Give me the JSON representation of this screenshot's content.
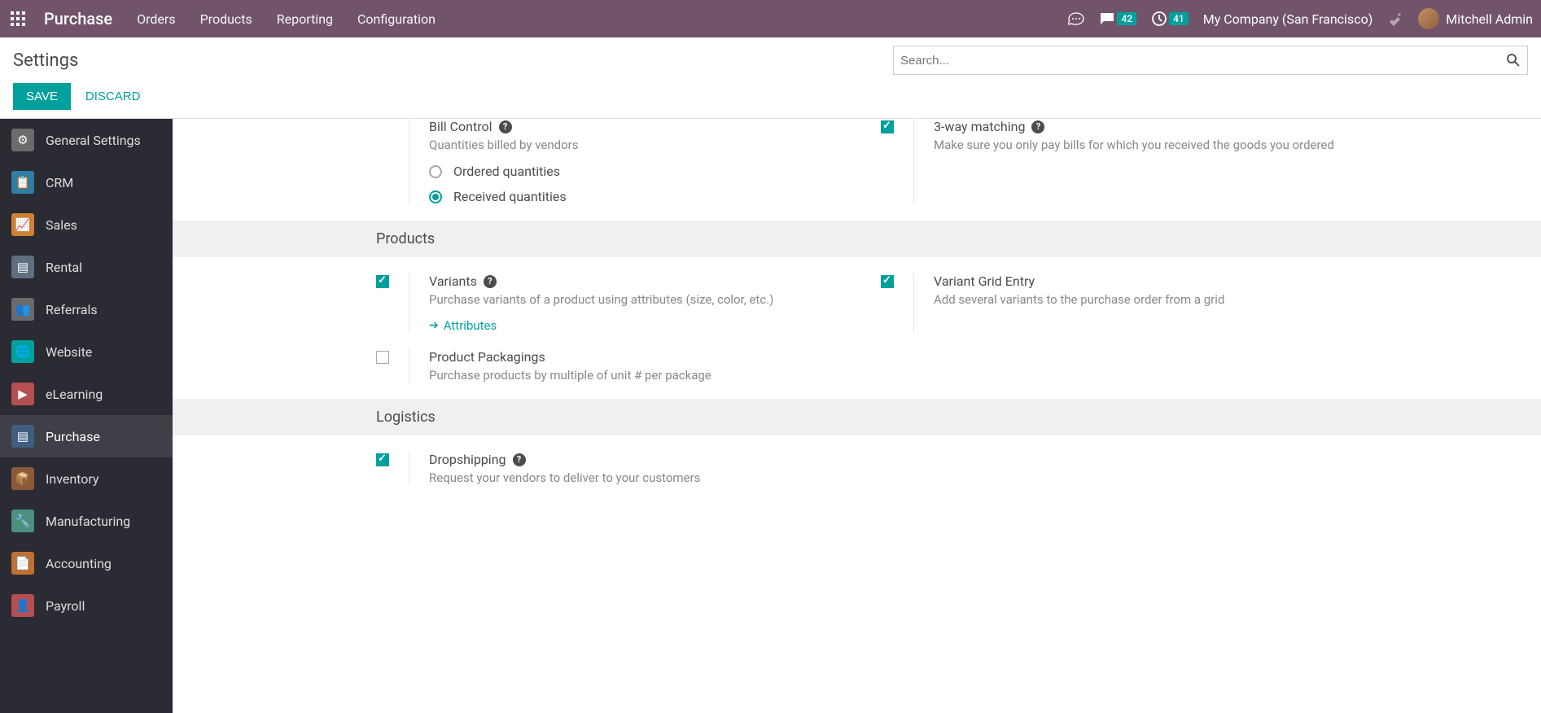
{
  "topbar": {
    "app_title": "Purchase",
    "menu": [
      "Orders",
      "Products",
      "Reporting",
      "Configuration"
    ],
    "messages_badge": "42",
    "activities_badge": "41",
    "company": "My Company (San Francisco)",
    "user": "Mitchell Admin"
  },
  "control_panel": {
    "title": "Settings",
    "search_placeholder": "Search...",
    "save": "SAVE",
    "discard": "DISCARD"
  },
  "sidebar": {
    "items": [
      {
        "label": "General Settings",
        "color": "#6b6b6b"
      },
      {
        "label": "CRM",
        "color": "#2f7ea3"
      },
      {
        "label": "Sales",
        "color": "#d08030"
      },
      {
        "label": "Rental",
        "color": "#5e6f7f"
      },
      {
        "label": "Referrals",
        "color": "#6b6b6b"
      },
      {
        "label": "Website",
        "color": "#00a09d"
      },
      {
        "label": "eLearning",
        "color": "#b55050"
      },
      {
        "label": "Purchase",
        "color": "#3e5f7f"
      },
      {
        "label": "Inventory",
        "color": "#8a5a3a"
      },
      {
        "label": "Manufacturing",
        "color": "#4c9080"
      },
      {
        "label": "Accounting",
        "color": "#c07030"
      },
      {
        "label": "Payroll",
        "color": "#b55050"
      }
    ],
    "active_index": 7
  },
  "settings": {
    "bill_control": {
      "title": "Bill Control",
      "desc": "Quantities billed by vendors",
      "options": [
        "Ordered quantities",
        "Received quantities"
      ],
      "selected": 1
    },
    "three_way": {
      "title": "3-way matching",
      "desc": "Make sure you only pay bills for which you received the goods you ordered",
      "checked": true
    },
    "section_products": "Products",
    "variants": {
      "title": "Variants",
      "desc": "Purchase variants of a product using attributes (size, color, etc.)",
      "link": "Attributes",
      "checked": true
    },
    "variant_grid": {
      "title": "Variant Grid Entry",
      "desc": "Add several variants to the purchase order from a grid",
      "checked": true
    },
    "packagings": {
      "title": "Product Packagings",
      "desc": "Purchase products by multiple of unit # per package",
      "checked": false
    },
    "section_logistics": "Logistics",
    "dropship": {
      "title": "Dropshipping",
      "desc": "Request your vendors to deliver to your customers",
      "checked": true
    }
  }
}
